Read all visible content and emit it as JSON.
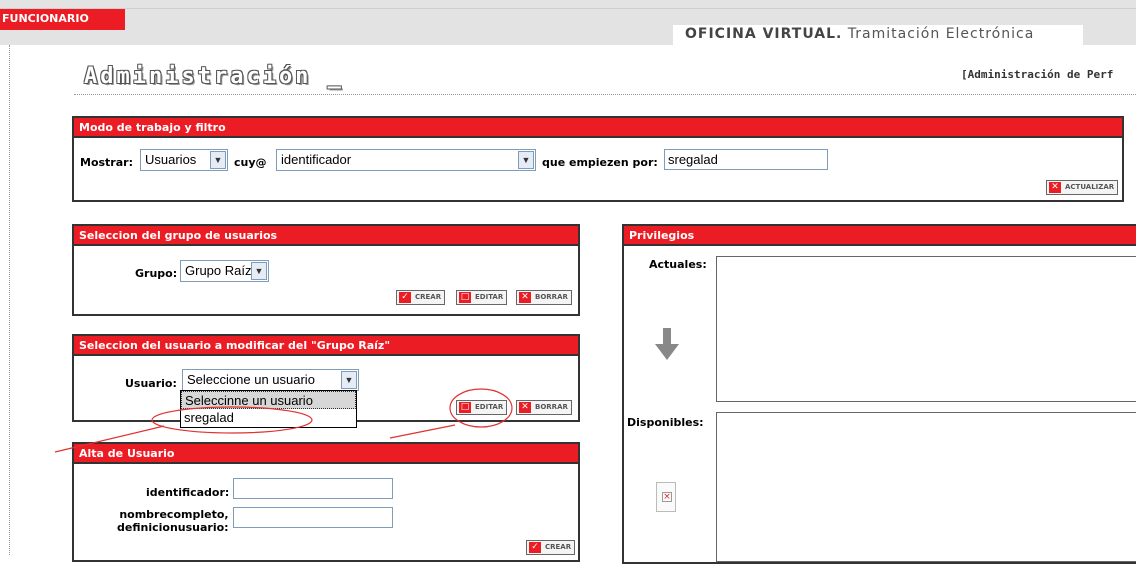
{
  "header": {
    "badge": "FUNCIONARIO",
    "oficina_bold": "OFICINA VIRTUAL.",
    "oficina_rest": " Tramitación Electrónica"
  },
  "admin": {
    "title": "Administración _",
    "right_text": "[Administración de Perf"
  },
  "filter_panel": {
    "title": "Modo de trabajo y filtro",
    "mostrar_label": "Mostrar:",
    "mostrar_value": "Usuarios",
    "cuyo_label": "cuy@",
    "cuyo_value": "identificador",
    "empiezen_label": "que empiezen por:",
    "empiezen_value": "sregalad",
    "update_button": "ACTUALIZAR"
  },
  "group_panel": {
    "title": "Seleccion del grupo de usuarios",
    "grupo_label": "Grupo:",
    "grupo_value": "Grupo Raíz",
    "create_button": "CREAR",
    "edit_button": "EDITAR",
    "delete_button": "BORRAR"
  },
  "user_panel": {
    "title": "Seleccion del usuario a modificar del \"Grupo Raíz\"",
    "usuario_label": "Usuario:",
    "usuario_value": "Seleccione un usuario",
    "edit_button": "EDITAR",
    "delete_button": "BORRAR",
    "options": [
      "Seleccinne un usuario",
      "sregalad"
    ]
  },
  "alta_panel": {
    "title": "Alta de Usuario",
    "identificador_label": "identificador:",
    "nombre_label_1": "nombrecompleto,",
    "nombre_label_2": "definicionusuario:",
    "create_button": "CREAR"
  },
  "privileges_panel": {
    "title": "Privilegios",
    "actuales_label": "Actuales:",
    "disponibles_label": "Disponibles:"
  },
  "colors": {
    "accent": "#ec1c24",
    "annotation": "#e0322f"
  }
}
